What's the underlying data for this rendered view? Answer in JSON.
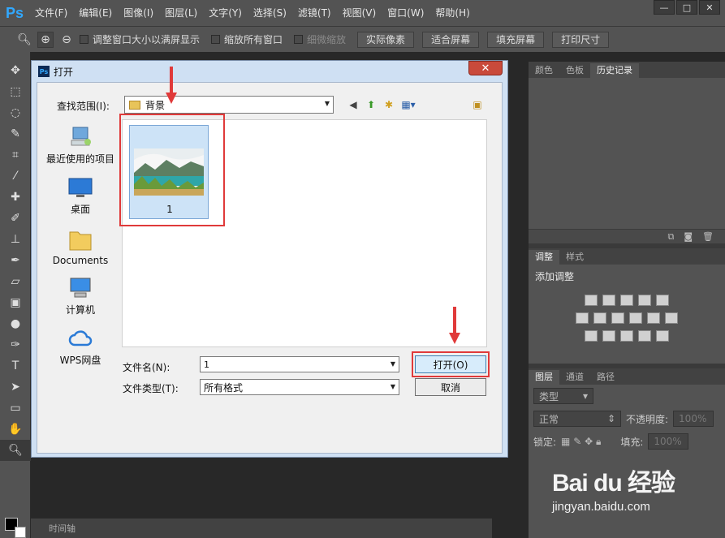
{
  "app": {
    "logo": "Ps"
  },
  "menu": [
    "文件(F)",
    "编辑(E)",
    "图像(I)",
    "图层(L)",
    "文字(Y)",
    "选择(S)",
    "滤镜(T)",
    "视图(V)",
    "窗口(W)",
    "帮助(H)"
  ],
  "window_controls": {
    "minimize": "—",
    "maximize": "□",
    "close": "✕"
  },
  "options": {
    "fit_window": "调整窗口大小以满屏显示",
    "zoom_all": "缩放所有窗口",
    "scrubby": "细微缩放",
    "actual_pixels": "实际像素",
    "fit_screen": "适合屏幕",
    "fill_screen": "填充屏幕",
    "print_size": "打印尺寸"
  },
  "panels": {
    "top_tabs": [
      "颜色",
      "色板",
      "历史记录"
    ],
    "adjust_tabs": [
      "调整",
      "样式"
    ],
    "add_adjustment": "添加调整",
    "layers_tabs": [
      "图层",
      "通道",
      "路径"
    ],
    "kind": "类型",
    "blend_mode": "正常",
    "opacity_label": "不透明度:",
    "opacity_value": "100%",
    "lock_label": "锁定:",
    "fill_label": "填充:",
    "fill_value": "100%"
  },
  "timeline": "时间轴",
  "dialog": {
    "title": "打开",
    "close": "✕",
    "look_in_label": "查找范围(I):",
    "look_in_value": "背景",
    "places": [
      "最近使用的项目",
      "桌面",
      "Documents",
      "计算机",
      "WPS网盘"
    ],
    "file_item": "1",
    "filename_label": "文件名(N):",
    "filename_value": "1",
    "filetype_label": "文件类型(T):",
    "filetype_value": "所有格式",
    "open_button": "打开(O)",
    "cancel_button": "取消"
  },
  "watermark": {
    "logo": "Bai du 经验",
    "url": "jingyan.baidu.com"
  },
  "colors": {
    "highlight": "#e03a3a",
    "ps_bg": "#535353",
    "dialog_frame": "#cfe0f3"
  }
}
